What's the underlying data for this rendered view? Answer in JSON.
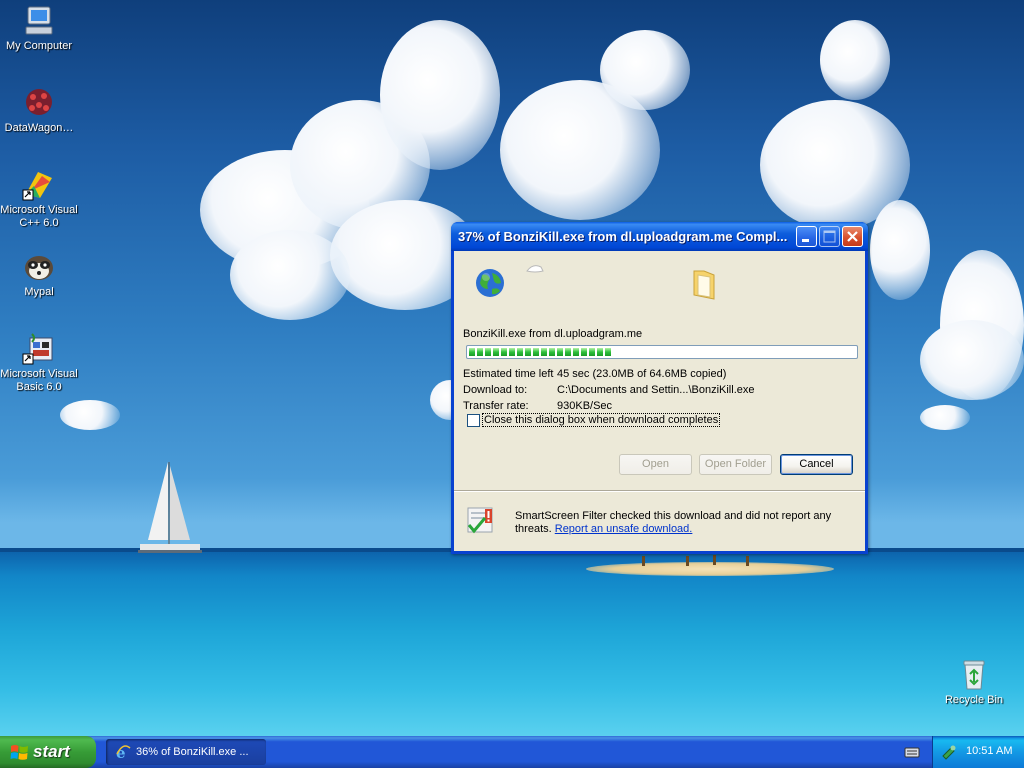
{
  "desktop": {
    "icons": [
      {
        "label": "My Computer",
        "icon": "computer-icon"
      },
      {
        "label": "DataWagon…",
        "icon": "datawagon-icon"
      },
      {
        "label": "Microsoft Visual C++ 6.0",
        "icon": "visual-cpp-icon"
      },
      {
        "label": "Mypal",
        "icon": "mypal-icon"
      },
      {
        "label": "Microsoft Visual Basic 6.0",
        "icon": "visual-basic-icon"
      },
      {
        "label": "Recycle Bin",
        "icon": "recycle-bin-icon"
      }
    ]
  },
  "dialog": {
    "title": "37% of BonziKill.exe from dl.uploadgram.me Compl...",
    "file_line": "BonziKill.exe from dl.uploadgram.me",
    "progress_percent": 37,
    "estimated_label": "Estimated time left",
    "estimated_value": "45 sec (23.0MB of 64.6MB copied)",
    "download_to_label": "Download to:",
    "download_to_value": "C:\\Documents and Settin...\\BonziKill.exe",
    "transfer_rate_label": "Transfer rate:",
    "transfer_rate_value": "930KB/Sec",
    "checkbox_label": "Close this dialog box when download completes",
    "checkbox_checked": false,
    "buttons": {
      "open": "Open",
      "open_folder": "Open Folder",
      "cancel": "Cancel"
    },
    "smartscreen_text": "SmartScreen Filter checked this download and did not report any threats.",
    "smartscreen_link": "Report an unsafe download."
  },
  "taskbar": {
    "start_label": "start",
    "task_label": "36% of BonziKill.exe ...",
    "clock": "10:51 AM"
  }
}
